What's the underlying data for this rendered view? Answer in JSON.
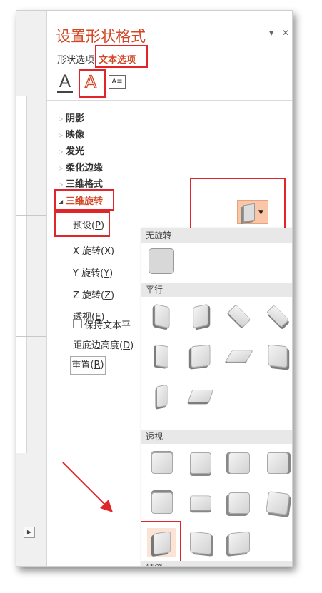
{
  "pane": {
    "title": "设置形状格式",
    "pin_glyph": "▾",
    "close_glyph": "✕",
    "tabs": [
      {
        "label": "形状选项"
      },
      {
        "label": "文本选项"
      }
    ],
    "icon_labels": {
      "text_fill": "A",
      "text_effects": "A"
    }
  },
  "sections": [
    {
      "label": "阴影"
    },
    {
      "label": "映像"
    },
    {
      "label": "发光"
    },
    {
      "label": "柔化边缘"
    },
    {
      "label": "三维格式"
    },
    {
      "label": "三维旋转"
    }
  ],
  "rotation_fields": {
    "preset": {
      "text": "预设",
      "hotkey": "P"
    },
    "x": {
      "text": "X 旋转",
      "hotkey": "X"
    },
    "y": {
      "text": "Y 旋转",
      "hotkey": "Y"
    },
    "z": {
      "text": "Z 旋转",
      "hotkey": "Z"
    },
    "perspective": {
      "text": "透视",
      "hotkey": "E"
    },
    "keep_flat": {
      "text": "保持文本平"
    },
    "distance": {
      "text": "距底边高度",
      "hotkey": "D"
    },
    "reset": {
      "text": "重置",
      "hotkey": "R"
    }
  },
  "gallery": {
    "headers": [
      "无旋转",
      "平行",
      "透视",
      "倾斜"
    ]
  },
  "colors": {
    "accent": "#d24726",
    "highlight_box": "#e0262a",
    "selected_fill": "#fbe3d6",
    "preset_button_fill": "#f9c7a7"
  }
}
